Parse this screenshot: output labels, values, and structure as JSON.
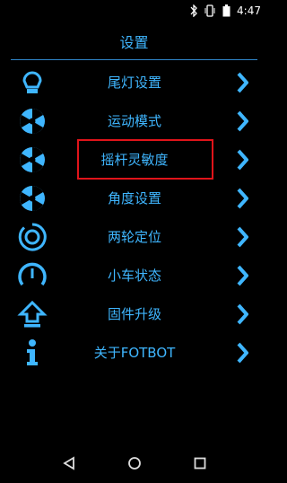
{
  "status": {
    "time": "4:47",
    "icons": [
      "bluetooth-icon",
      "vibrate-icon",
      "battery-icon"
    ]
  },
  "header": {
    "title": "设置"
  },
  "menu": [
    {
      "label": "尾灯设置",
      "icon": "tail-light-icon"
    },
    {
      "label": "运动模式",
      "icon": "wheel-icon"
    },
    {
      "label": "摇杆灵敏度",
      "icon": "wheel-icon"
    },
    {
      "label": "角度设置",
      "icon": "wheel-icon"
    },
    {
      "label": "两轮定位",
      "icon": "target-icon"
    },
    {
      "label": "小车状态",
      "icon": "gauge-icon"
    },
    {
      "label": "固件升级",
      "icon": "upload-arrow-icon"
    },
    {
      "label": "关于FOTBOT",
      "icon": "info-icon"
    }
  ],
  "highlight_color": "#e0141a",
  "accent_color": "#3fb6ff",
  "navigation": [
    "back-icon",
    "home-icon",
    "recents-icon"
  ]
}
